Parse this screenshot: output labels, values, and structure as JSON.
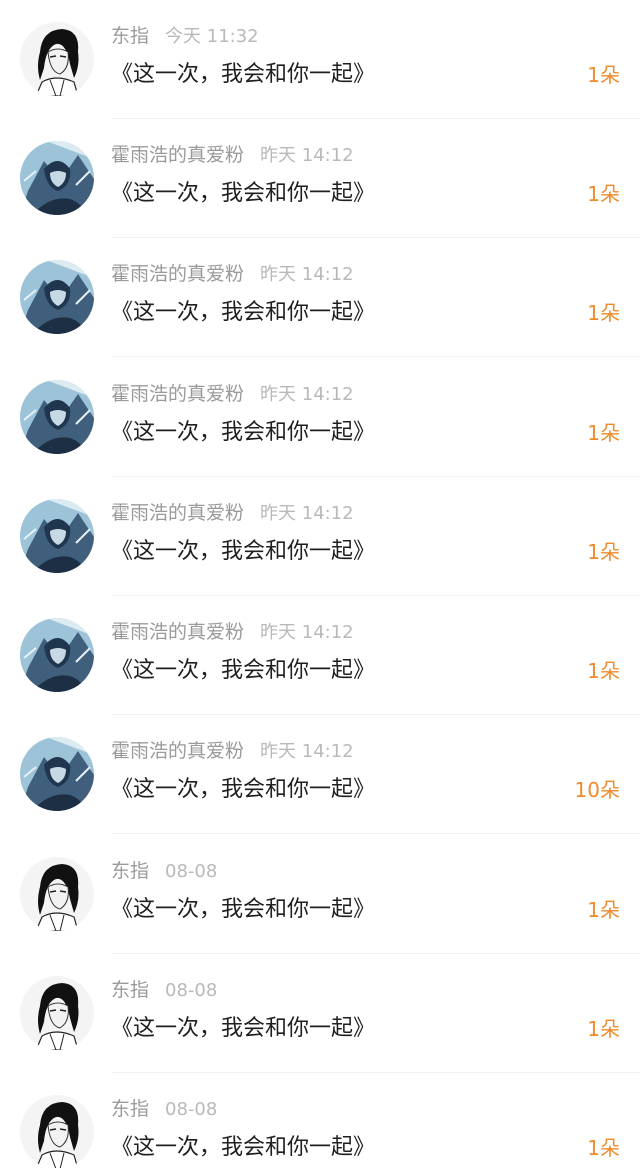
{
  "list": {
    "items": [
      {
        "avatar": "ink-boy-avatar",
        "name": "东指",
        "time": "今天 11:32",
        "title": "《这一次，我会和你一起》",
        "count": "1朵"
      },
      {
        "avatar": "blue-anime-avatar",
        "name": "霍雨浩的真爱粉",
        "time": "昨天 14:12",
        "title": "《这一次，我会和你一起》",
        "count": "1朵"
      },
      {
        "avatar": "blue-anime-avatar",
        "name": "霍雨浩的真爱粉",
        "time": "昨天 14:12",
        "title": "《这一次，我会和你一起》",
        "count": "1朵"
      },
      {
        "avatar": "blue-anime-avatar",
        "name": "霍雨浩的真爱粉",
        "time": "昨天 14:12",
        "title": "《这一次，我会和你一起》",
        "count": "1朵"
      },
      {
        "avatar": "blue-anime-avatar",
        "name": "霍雨浩的真爱粉",
        "time": "昨天 14:12",
        "title": "《这一次，我会和你一起》",
        "count": "1朵"
      },
      {
        "avatar": "blue-anime-avatar",
        "name": "霍雨浩的真爱粉",
        "time": "昨天 14:12",
        "title": "《这一次，我会和你一起》",
        "count": "1朵"
      },
      {
        "avatar": "blue-anime-avatar",
        "name": "霍雨浩的真爱粉",
        "time": "昨天 14:12",
        "title": "《这一次，我会和你一起》",
        "count": "10朵"
      },
      {
        "avatar": "ink-boy-avatar",
        "name": "东指",
        "time": "08-08",
        "title": "《这一次，我会和你一起》",
        "count": "1朵"
      },
      {
        "avatar": "ink-boy-avatar",
        "name": "东指",
        "time": "08-08",
        "title": "《这一次，我会和你一起》",
        "count": "1朵"
      },
      {
        "avatar": "ink-boy-avatar",
        "name": "东指",
        "time": "08-08",
        "title": "《这一次，我会和你一起》",
        "count": "1朵"
      }
    ]
  },
  "colors": {
    "background": "#ffffff",
    "name": "#9a9a9a",
    "time": "#b9b9b9",
    "title": "#1f1f1f",
    "count": "#f08a2a",
    "divider": "#f2f2f2"
  }
}
